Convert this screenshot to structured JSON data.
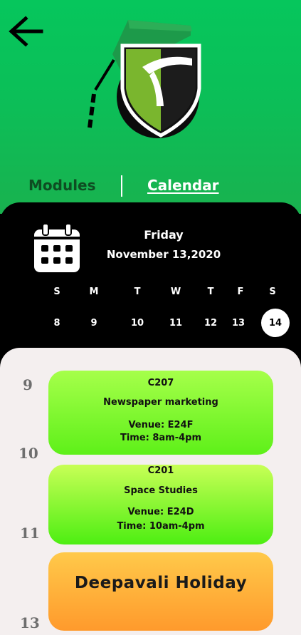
{
  "tabs": {
    "modules_label": "Modules",
    "calendar_label": "Calendar"
  },
  "calendar": {
    "day_name": "Friday",
    "full_date": "November 13,2020",
    "weekdays": [
      "S",
      "M",
      "T",
      "W",
      "T",
      "F",
      "S"
    ],
    "dates": [
      "8",
      "9",
      "10",
      "11",
      "12",
      "13",
      "14"
    ],
    "selected_date": "14"
  },
  "schedule": {
    "hours": [
      "9",
      "10",
      "11",
      "13"
    ],
    "events": [
      {
        "code": "C207",
        "title": "Newspaper marketing",
        "venue": "Venue: E24F",
        "time": "Time: 8am-4pm"
      },
      {
        "code": "C201",
        "title": "Space Studies",
        "venue": "Venue: E24D",
        "time": "Time: 10am-4pm"
      }
    ],
    "holiday": {
      "title": "Deepavali Holiday"
    }
  },
  "colors": {
    "header_green": "#06c65c",
    "event_green": "#7cf52c",
    "holiday_orange": "#ffb13a",
    "panel_black": "#000000",
    "schedule_bg": "#f4efef"
  },
  "icons": {
    "back": "arrow-left-icon",
    "logo": "graduation-shield-logo",
    "calendar": "calendar-icon"
  }
}
